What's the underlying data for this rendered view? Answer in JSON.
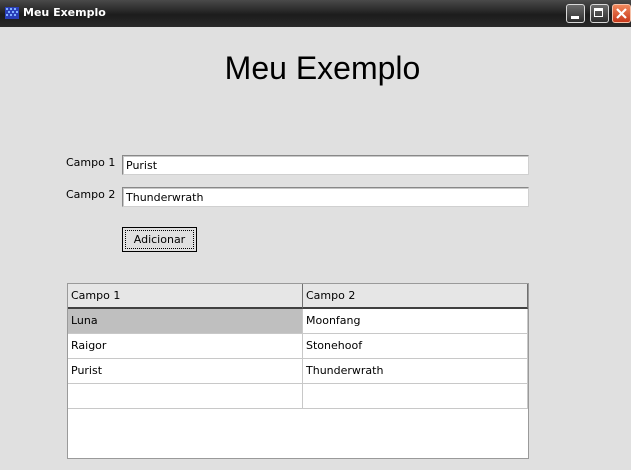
{
  "window": {
    "title": "Meu Exemplo",
    "icon": "grid-app-icon",
    "controls": [
      "minimize-icon",
      "maximize-icon",
      "close-icon"
    ]
  },
  "heading": "Meu Exemplo",
  "form": {
    "campo1": {
      "label": "Campo 1",
      "value": "Purist"
    },
    "campo2": {
      "label": "Campo 2",
      "value": "Thunderwrath"
    },
    "button_label": "Adicionar"
  },
  "table": {
    "columns": [
      "Campo 1",
      "Campo 2"
    ],
    "rows": [
      [
        "Luna",
        "Moonfang"
      ],
      [
        "Raigor",
        "Stonehoof"
      ],
      [
        "Purist",
        "Thunderwrath"
      ],
      [
        "",
        ""
      ]
    ],
    "selected_row": 0
  },
  "colors": {
    "window_bg": "#e0e0e0",
    "titlebar": "#2a2a2a",
    "close_button": "#d9532a",
    "selected_cell": "#bfbfbf"
  }
}
